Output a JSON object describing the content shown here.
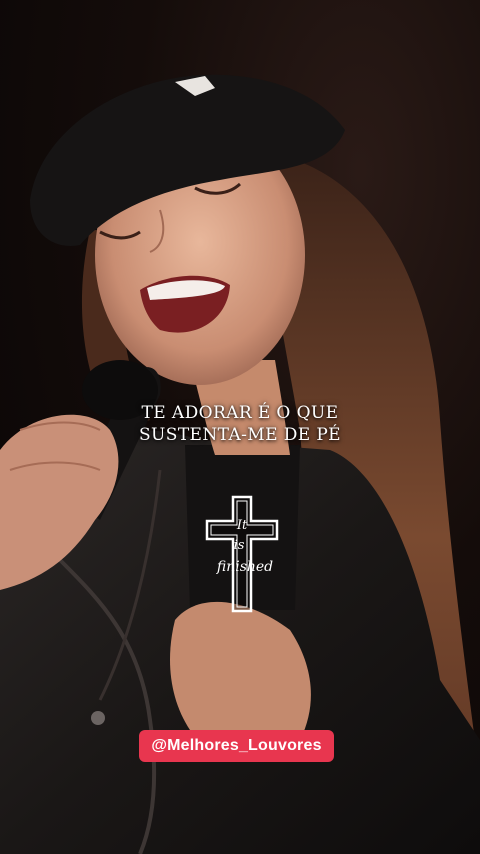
{
  "lyrics": {
    "line1": "TE ADORAR É O QUE",
    "line2": "SUSTENTA-ME DE PÉ"
  },
  "logo": {
    "text_line1": "It",
    "text_line2": "is",
    "text_line3": "finished"
  },
  "handle": {
    "label": "@Melhores_Louvores",
    "color": "#e8364f"
  }
}
